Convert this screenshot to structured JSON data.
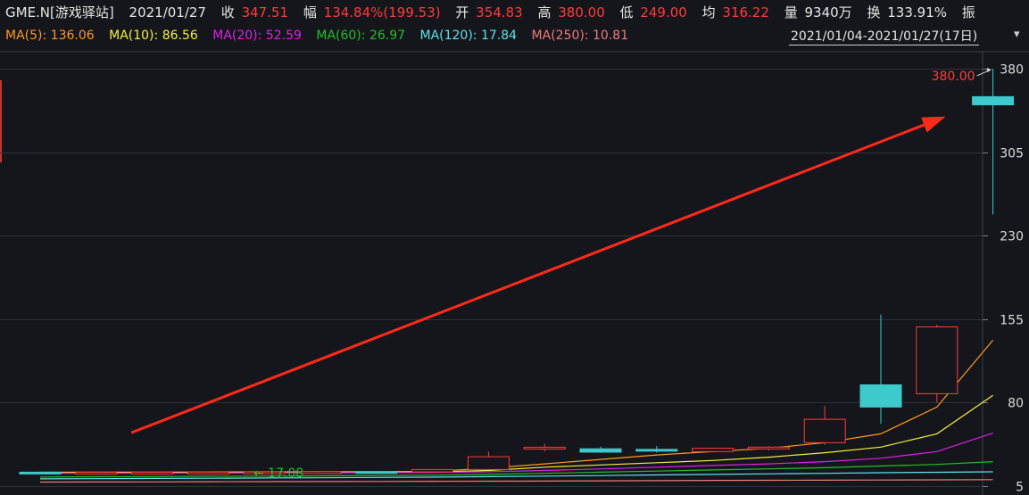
{
  "quote": {
    "symbol": "GME.N[游戏驿站]",
    "date": "2021/01/27",
    "close_label": "收",
    "close": "347.51",
    "change_label": "幅",
    "change": "134.84%(199.53)",
    "open_label": "开",
    "open": "354.83",
    "high_label": "高",
    "high": "380.00",
    "low_label": "低",
    "low": "249.00",
    "avg_label": "均",
    "avg": "316.22",
    "volume_label": "量",
    "volume": "9340万",
    "turnover_label": "换",
    "turnover": "133.91%",
    "amplitude_label": "振"
  },
  "ma_legend": [
    {
      "label": "MA(5):",
      "value": "136.06",
      "color": "#ff9a1f"
    },
    {
      "label": "MA(10):",
      "value": "86.56",
      "color": "#f5f03c"
    },
    {
      "label": "MA(20):",
      "value": "52.59",
      "color": "#e020e8"
    },
    {
      "label": "MA(60):",
      "value": "26.97",
      "color": "#22c02a"
    },
    {
      "label": "MA(120):",
      "value": "17.84",
      "color": "#5fe2ee"
    },
    {
      "label": "MA(250):",
      "value": "10.81",
      "color": "#f07a7a"
    }
  ],
  "range_selector": {
    "label": "2021/01/04-2021/01/27(17日)",
    "menu_icon": "chevron-down-icon"
  },
  "colors": {
    "up": "#ff3b3b",
    "down": "#3ec9cc",
    "grid": "#2e3138",
    "axis_text": "#dcdcdc",
    "arrow": "#ff2a1a",
    "min_label": "#22c02a"
  },
  "chart_data": {
    "type": "candlestick",
    "title": "",
    "yticks": [
      "5",
      "80",
      "155",
      "230",
      "305",
      "380"
    ],
    "ylim": [
      -3,
      392
    ],
    "grid": true,
    "high_annotation": "380.00",
    "low_annotation": "17.08",
    "candles": [
      {
        "o": 17.5,
        "h": 18.0,
        "l": 17.0,
        "c": 17.3
      },
      {
        "o": 17.3,
        "h": 17.6,
        "l": 17.08,
        "c": 17.3
      },
      {
        "o": 17.3,
        "h": 17.8,
        "l": 17.1,
        "c": 17.4
      },
      {
        "o": 17.4,
        "h": 17.8,
        "l": 17.2,
        "c": 17.5
      },
      {
        "o": 17.5,
        "h": 17.9,
        "l": 17.3,
        "c": 17.7
      },
      {
        "o": 17.7,
        "h": 18.2,
        "l": 17.4,
        "c": 18.0
      },
      {
        "o": 18.0,
        "h": 18.3,
        "l": 17.6,
        "c": 17.8
      },
      {
        "o": 17.8,
        "h": 20.0,
        "l": 17.5,
        "c": 19.9
      },
      {
        "o": 19.9,
        "h": 36.0,
        "l": 19.5,
        "c": 31.4
      },
      {
        "o": 38.5,
        "h": 43.0,
        "l": 36.0,
        "c": 39.9
      },
      {
        "o": 38.5,
        "h": 40.5,
        "l": 35.0,
        "c": 35.5
      },
      {
        "o": 38.0,
        "h": 41.0,
        "l": 35.0,
        "c": 37.0
      },
      {
        "o": 36.0,
        "h": 39.5,
        "l": 35.5,
        "c": 39.0
      },
      {
        "o": 39.0,
        "h": 41.0,
        "l": 37.0,
        "c": 40.0
      },
      {
        "o": 44.0,
        "h": 77.0,
        "l": 42.0,
        "c": 65.0
      },
      {
        "o": 96.0,
        "h": 159.0,
        "l": 61.0,
        "c": 76.0
      },
      {
        "o": 88.0,
        "h": 150.0,
        "l": 80.0,
        "c": 148.0
      },
      {
        "o": 354.83,
        "h": 380.0,
        "l": 249.0,
        "c": 347.51
      }
    ],
    "moving_averages": [
      {
        "name": "MA(5)",
        "values": [
          17.4,
          17.5,
          17.6,
          17.7,
          17.8,
          17.9,
          18.0,
          18.2,
          21.0,
          25.0,
          29.0,
          33.0,
          36.0,
          39.0,
          44.0,
          52.0,
          76.0,
          136.06
        ]
      },
      {
        "name": "MA(10)",
        "values": [
          16.8,
          16.9,
          17.0,
          17.1,
          17.2,
          17.3,
          17.4,
          17.6,
          19.0,
          22.0,
          24.0,
          26.0,
          28.0,
          31.0,
          35.0,
          40.0,
          52.0,
          86.56
        ]
      },
      {
        "name": "MA(20)",
        "values": [
          16.5,
          16.6,
          16.7,
          16.8,
          16.9,
          17.0,
          17.1,
          17.2,
          17.9,
          19.0,
          20.5,
          22.0,
          23.5,
          25.0,
          27.0,
          30.0,
          36.0,
          52.59
        ]
      },
      {
        "name": "MA(60)",
        "values": [
          13.2,
          13.4,
          13.6,
          13.8,
          14.0,
          14.2,
          14.5,
          14.8,
          15.5,
          16.5,
          17.5,
          18.5,
          19.5,
          20.5,
          21.5,
          23.0,
          24.5,
          26.97
        ]
      },
      {
        "name": "MA(120)",
        "values": [
          11.5,
          11.7,
          11.9,
          12.1,
          12.3,
          12.5,
          12.8,
          13.0,
          13.5,
          14.0,
          14.5,
          15.0,
          15.5,
          16.0,
          16.5,
          17.0,
          17.4,
          17.84
        ]
      },
      {
        "name": "MA(250)",
        "values": [
          8.6,
          8.7,
          8.8,
          8.9,
          9.0,
          9.1,
          9.2,
          9.3,
          9.4,
          9.5,
          9.7,
          9.9,
          10.1,
          10.2,
          10.3,
          10.5,
          10.6,
          10.81
        ]
      }
    ],
    "trend_arrow": {
      "from": {
        "index": 9,
        "value": 53
      },
      "to": {
        "index": 17,
        "value": 337
      }
    }
  }
}
